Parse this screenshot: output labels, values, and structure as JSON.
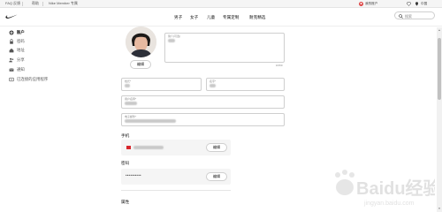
{
  "utility_bar": {
    "items": [
      "FAQ 反馈",
      "帮助",
      "Nike Member 专属"
    ]
  },
  "nav": {
    "links": [
      "男子",
      "女子",
      "儿童",
      "专属定制",
      "耐克精选"
    ],
    "profile_label": "我的账户",
    "search_placeholder": "搜索"
  },
  "sidebar": {
    "items": [
      {
        "label": "账户",
        "icon": "gear-icon",
        "active": true
      },
      {
        "label": "密码",
        "icon": "lock-icon",
        "active": false
      },
      {
        "label": "地址",
        "icon": "home-icon",
        "active": false
      },
      {
        "label": "分享",
        "icon": "people-icon",
        "active": false
      },
      {
        "label": "通知",
        "icon": "mail-icon",
        "active": false
      },
      {
        "label": "已连接的应用程序",
        "icon": "link-icon",
        "active": false
      }
    ]
  },
  "profile": {
    "edit_photo_label": "编辑",
    "bio_label": "简介(可选)",
    "bio_counter": "0/150",
    "first_name_label": "姓氏*",
    "last_name_label": "名字*",
    "username_label": "用户名称*",
    "email_label": "电子邮件*"
  },
  "phone": {
    "section_label": "手机",
    "edit_label": "编辑"
  },
  "password": {
    "section_label": "密码",
    "masked_value": "••••••••••",
    "edit_label": "编辑"
  },
  "footer_section": {
    "label": "属性"
  },
  "watermark": {
    "brand": "Baidu经验",
    "sub": "jingyan.baidu.com"
  },
  "colors": {
    "flag_red": "#d8262c",
    "scroll_thumb": "#c1c1c1"
  }
}
